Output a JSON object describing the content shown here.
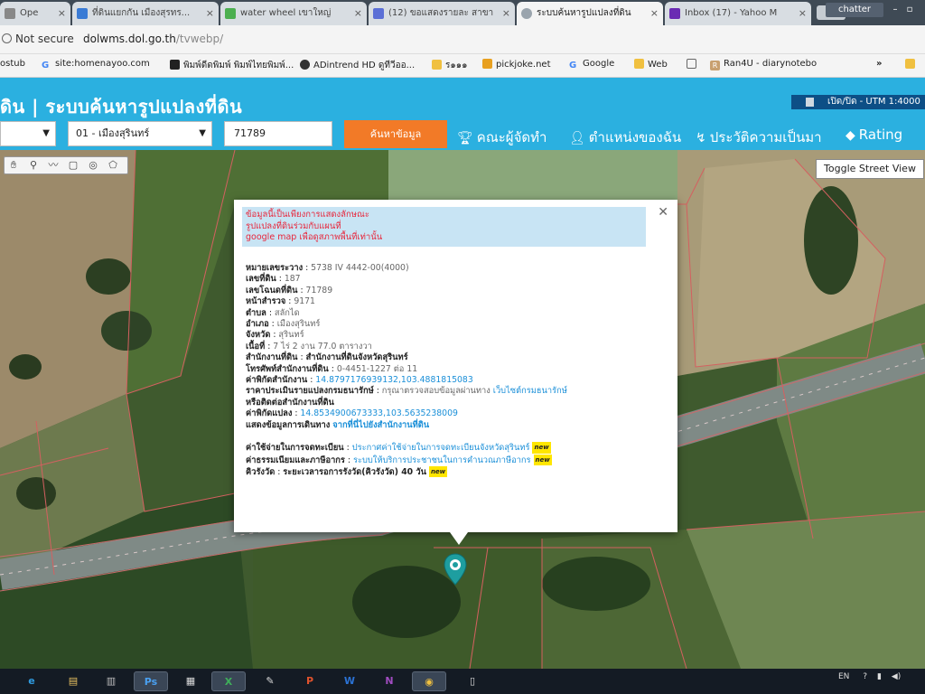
{
  "browser": {
    "tabs": [
      {
        "label": "Ope",
        "icon": "document-icon",
        "active": false
      },
      {
        "label": "ที่ดินแยกกัน เมืองสุรทร...",
        "icon": "house-icon",
        "active": false
      },
      {
        "label": "water wheel เขาใหญ่",
        "icon": "maps-icon",
        "active": false
      },
      {
        "label": "(12) ขอแสดงรายละ สาขา",
        "icon": "k-icon",
        "active": false
      },
      {
        "label": "ระบบค้นหารูปแปลงที่ดิน",
        "icon": "globe-icon",
        "active": true
      },
      {
        "label": "Inbox (17) - Yahoo M",
        "icon": "mail-icon",
        "active": false
      }
    ],
    "window_user": "chatter",
    "security_label": "Not secure",
    "url_host": "dolwms.dol.go.th",
    "url_path": "/tvwebp/",
    "bookmarks": [
      {
        "label": "ostub",
        "icon": "folder-icon"
      },
      {
        "label": "site:homenayoo.com",
        "icon": "google-icon"
      },
      {
        "label": "พิมพ์ดีดพิมพ์ พิมพ์ไทยพิมพ์...",
        "icon": "keyboard-icon"
      },
      {
        "label": "ADintrend HD ดูทีวีออ...",
        "icon": "person-icon"
      },
      {
        "label": "ร๑๑๑",
        "icon": "folder-icon"
      },
      {
        "label": "pickjoke.net",
        "icon": "folder-icon"
      },
      {
        "label": "Google",
        "icon": "google-icon"
      },
      {
        "label": "Web",
        "icon": "folder-icon"
      },
      {
        "label": "",
        "icon": "page-icon"
      },
      {
        "label": "Ran4U - diarynotebo",
        "icon": "r-icon"
      },
      {
        "label": "»",
        "icon": ""
      }
    ]
  },
  "app": {
    "title": "ดิน | ระบบค้นหารูปแปลงที่ดิน",
    "utm_label": "เปิด/ปิด - UTM 1:4000",
    "province_select": "",
    "district_select": "01 - เมืองสุรินทร์",
    "parcel_input": "71789",
    "search_button": "ค้นหาข้อมูล",
    "nav": [
      {
        "label": "คณะผู้จัดทำ",
        "icon": "trophy-icon"
      },
      {
        "label": "ตำแหน่งของฉัน",
        "icon": "person-icon"
      },
      {
        "label": "ประวัติความเป็นมา",
        "icon": "history-icon"
      },
      {
        "label": "Rating",
        "icon": "tag-icon"
      }
    ],
    "toggle_street_view": "Toggle Street View"
  },
  "popup": {
    "notice": [
      "ข้อมูลนี้เป็นเพียงการแสดงลักษณะ",
      "รูปแปลงที่ดินร่วมกับแผนที่",
      "google map เพื่อดูสภาพพื้นที่เท่านั้น"
    ],
    "fields": [
      {
        "label": "หมายเลขระวาง",
        "value": "5738 IV 4442-00(4000)"
      },
      {
        "label": "เลขที่ดิน",
        "value": "187"
      },
      {
        "label": "เลขโฉนดที่ดิน",
        "value": "71789"
      },
      {
        "label": "หน้าสำรวจ",
        "value": "9171"
      },
      {
        "label": "ตำบล",
        "value": "สลักได"
      },
      {
        "label": "อำเภอ",
        "value": "เมืองสุรินทร์"
      },
      {
        "label": "จังหวัด",
        "value": "สุรินทร์"
      },
      {
        "label": "เนื้อที่",
        "value": "7 ไร่ 2 งาน 77.0 ตารางวา"
      },
      {
        "label": "สำนักงานที่ดิน",
        "value": "สำนักงานที่ดินจังหวัดสุรินทร์"
      },
      {
        "label": "โทรศัพท์สำนักงานที่ดิน",
        "value": "0-4451-1227 ต่อ 11"
      },
      {
        "label": "ค่าพิกัดสำนักงาน",
        "value": "14.8797176939132,103.4881815083"
      }
    ],
    "appraisal": {
      "label": "ราคาประเมินรายแปลงกรมธนารักษ์",
      "text": "กรุณาตรวจสอบข้อมูลผ่านทาง",
      "link": "เว็บไซต์กรมธนารักษ์",
      "line2": "หรือติดต่อสำนักงานที่ดิน"
    },
    "parcel_coord": {
      "label": "ค่าพิกัดแปลง",
      "value": "14.8534900673333,103.5635238009"
    },
    "directions": {
      "label": "แสดงข้อมูลการเดินทาง",
      "link": "จากที่นี่ไปยังสำนักงานที่ดิน"
    },
    "extra": [
      {
        "label": "ค่าใช้จ่ายในการจดทะเบียน",
        "link": "ประกาศค่าใช้จ่ายในการจดทะเบียนจังหวัดสุรินทร์",
        "badge": "new"
      },
      {
        "label": "ค่าธรรมเนียมและภาษีอากร",
        "link": "ระบบให้บริการประชาชนในการคำนวณภาษีอากร",
        "badge": "new"
      },
      {
        "label": "คิวรังวัด",
        "value": "ระยะเวลารอการรังวัด(คิวรังวัด) 40 วัน",
        "badge": "new"
      }
    ]
  },
  "taskbar": {
    "apps": [
      "ie-icon",
      "explorer-icon",
      "folder-icon",
      "photoshop-icon",
      "notepad-icon",
      "excel-icon",
      "paint-icon",
      "powerpoint-icon",
      "word-icon",
      "onenote-icon",
      "chrome-icon",
      "document-icon"
    ],
    "lang": "EN"
  },
  "colors": {
    "header": "#2bb0e0",
    "search_button": "#f27a27",
    "alert_text": "#e8253a",
    "link": "#1a8fd8",
    "utm": "#0d4f86"
  }
}
